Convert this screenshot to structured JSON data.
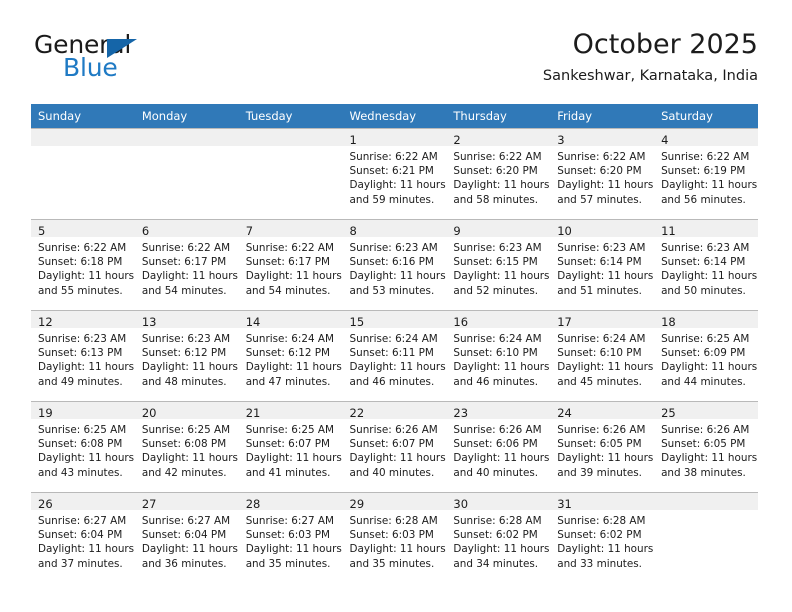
{
  "brand": {
    "name_top": "General",
    "name_bottom": "Blue",
    "accent_color": "#1f7ac4",
    "flag_color": "#1565a8"
  },
  "header": {
    "month_title": "October 2025",
    "location": "Sankeshwar, Karnataka, India"
  },
  "calendar": {
    "header_bg": "#3079b8",
    "daynum_bg": "#f0f0f0",
    "border_color": "#b9b9b9",
    "weekday_headers": [
      "Sunday",
      "Monday",
      "Tuesday",
      "Wednesday",
      "Thursday",
      "Friday",
      "Saturday"
    ],
    "weeks": [
      [
        {
          "empty": true
        },
        {
          "empty": true
        },
        {
          "empty": true
        },
        {
          "day": "1",
          "sunrise": "Sunrise: 6:22 AM",
          "sunset": "Sunset: 6:21 PM",
          "daylight_1": "Daylight: 11 hours",
          "daylight_2": "and 59 minutes."
        },
        {
          "day": "2",
          "sunrise": "Sunrise: 6:22 AM",
          "sunset": "Sunset: 6:20 PM",
          "daylight_1": "Daylight: 11 hours",
          "daylight_2": "and 58 minutes."
        },
        {
          "day": "3",
          "sunrise": "Sunrise: 6:22 AM",
          "sunset": "Sunset: 6:20 PM",
          "daylight_1": "Daylight: 11 hours",
          "daylight_2": "and 57 minutes."
        },
        {
          "day": "4",
          "sunrise": "Sunrise: 6:22 AM",
          "sunset": "Sunset: 6:19 PM",
          "daylight_1": "Daylight: 11 hours",
          "daylight_2": "and 56 minutes."
        }
      ],
      [
        {
          "day": "5",
          "sunrise": "Sunrise: 6:22 AM",
          "sunset": "Sunset: 6:18 PM",
          "daylight_1": "Daylight: 11 hours",
          "daylight_2": "and 55 minutes."
        },
        {
          "day": "6",
          "sunrise": "Sunrise: 6:22 AM",
          "sunset": "Sunset: 6:17 PM",
          "daylight_1": "Daylight: 11 hours",
          "daylight_2": "and 54 minutes."
        },
        {
          "day": "7",
          "sunrise": "Sunrise: 6:22 AM",
          "sunset": "Sunset: 6:17 PM",
          "daylight_1": "Daylight: 11 hours",
          "daylight_2": "and 54 minutes."
        },
        {
          "day": "8",
          "sunrise": "Sunrise: 6:23 AM",
          "sunset": "Sunset: 6:16 PM",
          "daylight_1": "Daylight: 11 hours",
          "daylight_2": "and 53 minutes."
        },
        {
          "day": "9",
          "sunrise": "Sunrise: 6:23 AM",
          "sunset": "Sunset: 6:15 PM",
          "daylight_1": "Daylight: 11 hours",
          "daylight_2": "and 52 minutes."
        },
        {
          "day": "10",
          "sunrise": "Sunrise: 6:23 AM",
          "sunset": "Sunset: 6:14 PM",
          "daylight_1": "Daylight: 11 hours",
          "daylight_2": "and 51 minutes."
        },
        {
          "day": "11",
          "sunrise": "Sunrise: 6:23 AM",
          "sunset": "Sunset: 6:14 PM",
          "daylight_1": "Daylight: 11 hours",
          "daylight_2": "and 50 minutes."
        }
      ],
      [
        {
          "day": "12",
          "sunrise": "Sunrise: 6:23 AM",
          "sunset": "Sunset: 6:13 PM",
          "daylight_1": "Daylight: 11 hours",
          "daylight_2": "and 49 minutes."
        },
        {
          "day": "13",
          "sunrise": "Sunrise: 6:23 AM",
          "sunset": "Sunset: 6:12 PM",
          "daylight_1": "Daylight: 11 hours",
          "daylight_2": "and 48 minutes."
        },
        {
          "day": "14",
          "sunrise": "Sunrise: 6:24 AM",
          "sunset": "Sunset: 6:12 PM",
          "daylight_1": "Daylight: 11 hours",
          "daylight_2": "and 47 minutes."
        },
        {
          "day": "15",
          "sunrise": "Sunrise: 6:24 AM",
          "sunset": "Sunset: 6:11 PM",
          "daylight_1": "Daylight: 11 hours",
          "daylight_2": "and 46 minutes."
        },
        {
          "day": "16",
          "sunrise": "Sunrise: 6:24 AM",
          "sunset": "Sunset: 6:10 PM",
          "daylight_1": "Daylight: 11 hours",
          "daylight_2": "and 46 minutes."
        },
        {
          "day": "17",
          "sunrise": "Sunrise: 6:24 AM",
          "sunset": "Sunset: 6:10 PM",
          "daylight_1": "Daylight: 11 hours",
          "daylight_2": "and 45 minutes."
        },
        {
          "day": "18",
          "sunrise": "Sunrise: 6:25 AM",
          "sunset": "Sunset: 6:09 PM",
          "daylight_1": "Daylight: 11 hours",
          "daylight_2": "and 44 minutes."
        }
      ],
      [
        {
          "day": "19",
          "sunrise": "Sunrise: 6:25 AM",
          "sunset": "Sunset: 6:08 PM",
          "daylight_1": "Daylight: 11 hours",
          "daylight_2": "and 43 minutes."
        },
        {
          "day": "20",
          "sunrise": "Sunrise: 6:25 AM",
          "sunset": "Sunset: 6:08 PM",
          "daylight_1": "Daylight: 11 hours",
          "daylight_2": "and 42 minutes."
        },
        {
          "day": "21",
          "sunrise": "Sunrise: 6:25 AM",
          "sunset": "Sunset: 6:07 PM",
          "daylight_1": "Daylight: 11 hours",
          "daylight_2": "and 41 minutes."
        },
        {
          "day": "22",
          "sunrise": "Sunrise: 6:26 AM",
          "sunset": "Sunset: 6:07 PM",
          "daylight_1": "Daylight: 11 hours",
          "daylight_2": "and 40 minutes."
        },
        {
          "day": "23",
          "sunrise": "Sunrise: 6:26 AM",
          "sunset": "Sunset: 6:06 PM",
          "daylight_1": "Daylight: 11 hours",
          "daylight_2": "and 40 minutes."
        },
        {
          "day": "24",
          "sunrise": "Sunrise: 6:26 AM",
          "sunset": "Sunset: 6:05 PM",
          "daylight_1": "Daylight: 11 hours",
          "daylight_2": "and 39 minutes."
        },
        {
          "day": "25",
          "sunrise": "Sunrise: 6:26 AM",
          "sunset": "Sunset: 6:05 PM",
          "daylight_1": "Daylight: 11 hours",
          "daylight_2": "and 38 minutes."
        }
      ],
      [
        {
          "day": "26",
          "sunrise": "Sunrise: 6:27 AM",
          "sunset": "Sunset: 6:04 PM",
          "daylight_1": "Daylight: 11 hours",
          "daylight_2": "and 37 minutes."
        },
        {
          "day": "27",
          "sunrise": "Sunrise: 6:27 AM",
          "sunset": "Sunset: 6:04 PM",
          "daylight_1": "Daylight: 11 hours",
          "daylight_2": "and 36 minutes."
        },
        {
          "day": "28",
          "sunrise": "Sunrise: 6:27 AM",
          "sunset": "Sunset: 6:03 PM",
          "daylight_1": "Daylight: 11 hours",
          "daylight_2": "and 35 minutes."
        },
        {
          "day": "29",
          "sunrise": "Sunrise: 6:28 AM",
          "sunset": "Sunset: 6:03 PM",
          "daylight_1": "Daylight: 11 hours",
          "daylight_2": "and 35 minutes."
        },
        {
          "day": "30",
          "sunrise": "Sunrise: 6:28 AM",
          "sunset": "Sunset: 6:02 PM",
          "daylight_1": "Daylight: 11 hours",
          "daylight_2": "and 34 minutes."
        },
        {
          "day": "31",
          "sunrise": "Sunrise: 6:28 AM",
          "sunset": "Sunset: 6:02 PM",
          "daylight_1": "Daylight: 11 hours",
          "daylight_2": "and 33 minutes."
        },
        {
          "empty": true
        }
      ]
    ]
  }
}
